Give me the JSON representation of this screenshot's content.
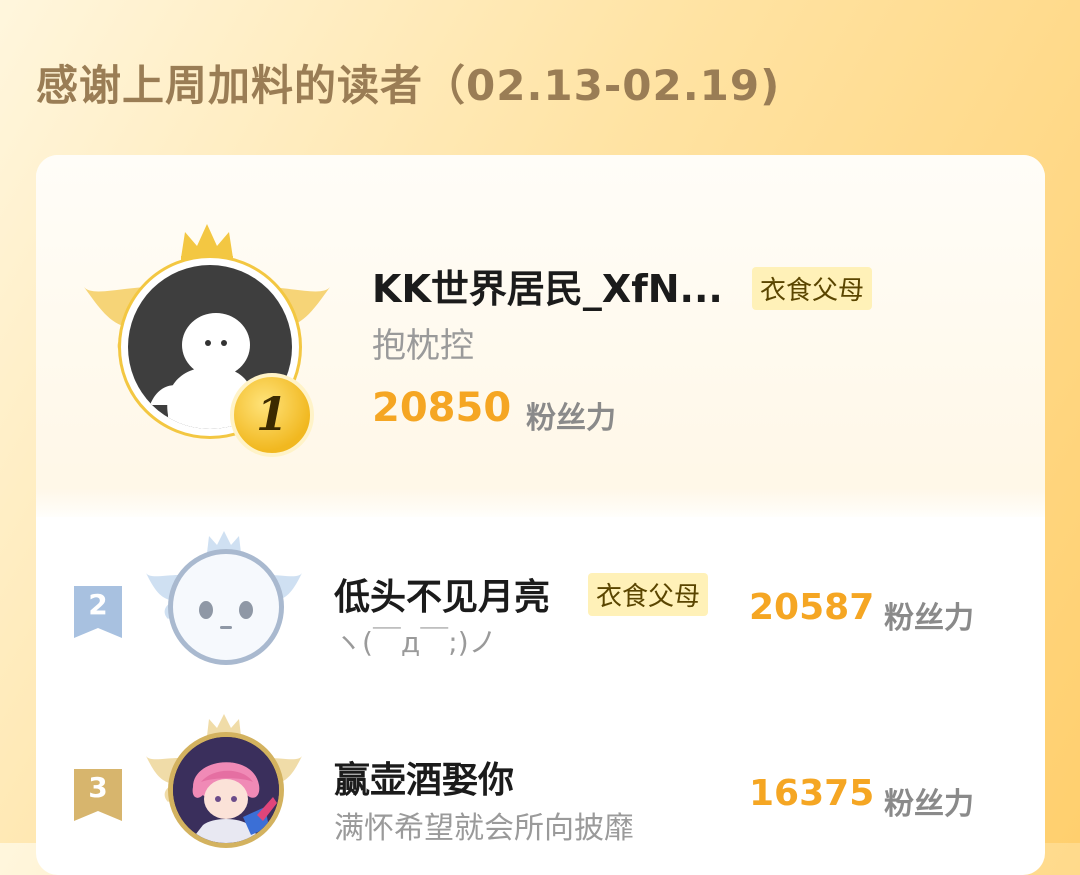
{
  "page": {
    "title": "感谢上周加料的读者（02.13-02.19)"
  },
  "colors": {
    "accent_orange": "#f5a623",
    "gold": "#f1c232",
    "tag_bg": "#fff1b8",
    "silver": "#9db7d6",
    "bronze": "#d6b46a"
  },
  "readers": [
    {
      "rank": "1",
      "nickname": "KK世界居民_XfN...",
      "badge": "衣食父母",
      "subtitle": "抱枕控",
      "score": "20850",
      "unit": "粉丝力"
    },
    {
      "rank": "2",
      "nickname": "低头不见月亮",
      "badge": "衣食父母",
      "subtitle": "ヽ(￣д￣;)ノ",
      "score": "20587",
      "unit": "粉丝力"
    },
    {
      "rank": "3",
      "nickname": "赢壶酒娶你",
      "subtitle": "满怀希望就会所向披靡",
      "score": "16375",
      "unit": "粉丝力"
    }
  ],
  "icons": {
    "crown": "crown-icon",
    "wings": "wings-icon",
    "medal": "rank-medal-icon"
  }
}
